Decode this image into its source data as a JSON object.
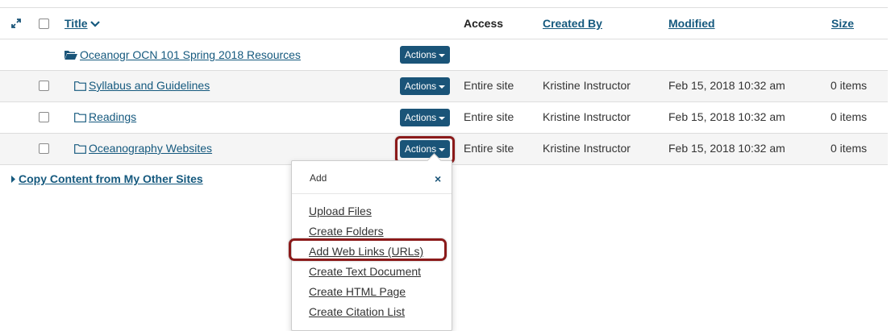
{
  "header": {
    "title_label": "Title",
    "access_label": "Access",
    "created_by_label": "Created By",
    "modified_label": "Modified",
    "size_label": "Size"
  },
  "parent_folder": {
    "name": "Oceanogr OCN 101 Spring 2018 Resources",
    "actions_label": "Actions"
  },
  "rows": [
    {
      "name": "Syllabus and Guidelines",
      "actions_label": "Actions",
      "access": "Entire site",
      "created_by": "Kristine Instructor",
      "modified": "Feb 15, 2018 10:32 am",
      "size": "0 items"
    },
    {
      "name": "Readings",
      "actions_label": "Actions",
      "access": "Entire site",
      "created_by": "Kristine Instructor",
      "modified": "Feb 15, 2018 10:32 am",
      "size": "0 items"
    },
    {
      "name": "Oceanography Websites",
      "actions_label": "Actions",
      "access": "Entire site",
      "created_by": "Kristine Instructor",
      "modified": "Feb 15, 2018 10:32 am",
      "size": "0 items"
    }
  ],
  "copy_content_link": "Copy Content from My Other Sites",
  "menu": {
    "title": "Add",
    "close_symbol": "×",
    "items": [
      "Upload Files",
      "Create Folders",
      "Add Web Links (URLs)",
      "Create Text Document",
      "Create HTML Page",
      "Create Citation List"
    ]
  },
  "colors": {
    "action_button": "#1a5478",
    "link": "#15597e",
    "highlight": "#8b1a1a"
  },
  "icons": [
    "expand-icon",
    "sort-chevron-down-icon",
    "folder-open-icon",
    "folder-icon",
    "caret-down-icon",
    "caret-right-icon",
    "close-icon"
  ]
}
